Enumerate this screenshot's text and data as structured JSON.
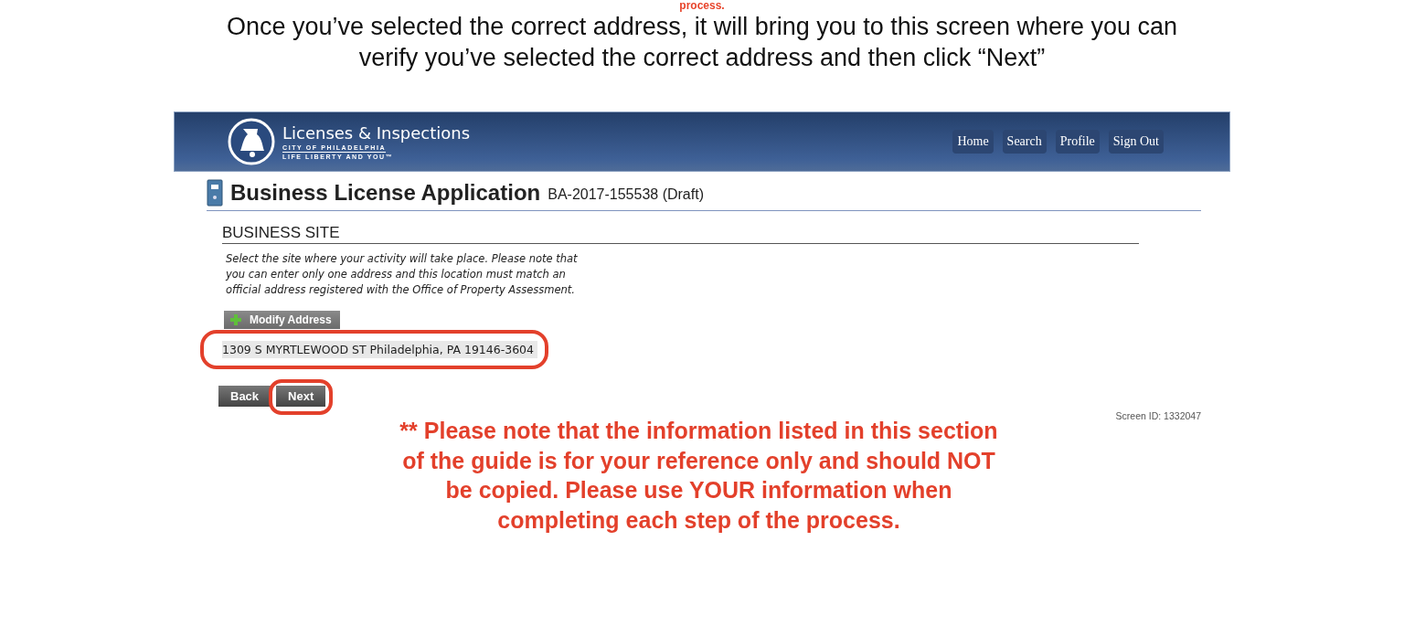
{
  "guide": {
    "cut_heading": "process.",
    "intro": "Once you’ve selected the correct address, it will bring you to this screen where you can verify you’ve selected the correct address and then click “Next”"
  },
  "site": {
    "brand": "Licenses & Inspections",
    "city": "CITY OF PHILADELPHIA",
    "tagline": "LIFE LIBERTY AND YOU™",
    "nav": [
      "Home",
      "Search",
      "Profile",
      "Sign Out"
    ]
  },
  "page": {
    "title": "Business License Application",
    "application_id": "BA-2017-155538 (Draft)",
    "section": "BUSINESS SITE",
    "instructions": "Select the site where your activity will take place. Please note that you can enter only one address and this location must match an official address registered with the Office of Property Assessment.",
    "modify_button": "Modify Address",
    "address": {
      "text": "1309 S MYRTLEWOOD ST Philadelphia, PA 19146-3604",
      "highlighted": true
    },
    "buttons": [
      {
        "label": "Back",
        "highlighted": false
      },
      {
        "label": "Next",
        "highlighted": true
      }
    ],
    "screen_id": "Screen ID: 1332047"
  },
  "note": "** Please note that the information listed in this section of the guide is for your reference only and should NOT be copied. Please use YOUR information when completing each step of the process."
}
